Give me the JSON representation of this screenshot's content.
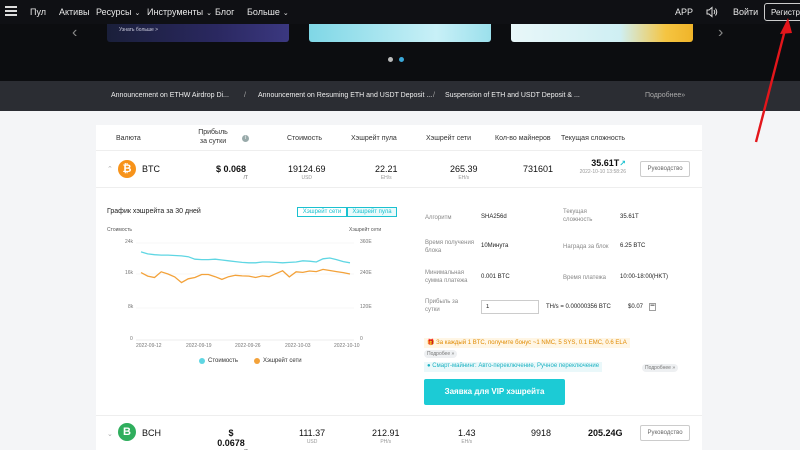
{
  "nav": {
    "items": [
      "Пул",
      "Активы",
      "Ресурсы",
      "Инструменты",
      "Блог",
      "Больше"
    ],
    "app": "APP",
    "login": "Войти",
    "register": "Регистрация"
  },
  "banner": {
    "slide1_text": "Узнать больше >"
  },
  "announcements": {
    "items": [
      "Announcement on ETHW Airdrop Di...",
      "Announcement on Resuming ETH and USDT Deposit ...",
      "Suspension of ETH and USDT Deposit & ..."
    ],
    "more": "Подробнее»"
  },
  "table": {
    "headers": {
      "currency": "Валюта",
      "profit": "Прибыль за сутки",
      "price": "Стоимость",
      "pool_hash": "Хэшрейт пула",
      "net_hash": "Хэшрейт сети",
      "miners": "Кол-во майнеров",
      "difficulty": "Текущая сложность"
    },
    "rows": [
      {
        "coin": "BTC",
        "profit": "$ 0.068",
        "profit_unit": "/T",
        "price": "19124.69",
        "price_unit": "USD",
        "pool_hash": "22.21",
        "pool_hash_unit": "EH/s",
        "net_hash": "265.39",
        "net_hash_unit": "EH/s",
        "miners": "731601",
        "difficulty": "35.61T",
        "difficulty_time": "2022-10-10 13:58:26",
        "guide": "Руководство"
      },
      {
        "coin": "BCH",
        "profit": "$ 0.0678",
        "profit_unit": "/T",
        "price": "111.37",
        "price_unit": "USD",
        "pool_hash": "212.91",
        "pool_hash_unit": "PH/s",
        "net_hash": "1.43",
        "net_hash_unit": "EH/s",
        "miners": "9918",
        "difficulty": "205.24G",
        "guide": "Руководство"
      }
    ]
  },
  "chart_data": {
    "type": "line",
    "title": "График хэшрейта за 30 дней",
    "toggles": [
      "Хэшрейт сети",
      "Хэшрейт пула"
    ],
    "ylabel_left": "Стоимость",
    "ylabel_right": "Хэшрейт сети",
    "left_ticks": [
      "24k",
      "16k",
      "8k",
      "0"
    ],
    "right_ticks": [
      "360E",
      "240E",
      "120E",
      "0"
    ],
    "x_ticks": [
      "2022-09-12",
      "2022-09-19",
      "2022-09-26",
      "2022-10-03",
      "2022-10-10"
    ],
    "ylim_left": [
      0,
      24000
    ],
    "ylim_right": [
      0,
      360
    ],
    "series": [
      {
        "name": "Стоимость",
        "color": "#5fd6e3",
        "axis": "left",
        "values": [
          21800,
          21300,
          21100,
          21000,
          21000,
          20900,
          20800,
          20600,
          20000,
          19900,
          19900,
          20000,
          19800,
          19600,
          19400,
          19200,
          19100,
          19100,
          19300,
          19300,
          19200,
          19100,
          19200,
          19300,
          19600,
          19500,
          19300,
          20100,
          20300,
          19900,
          19400,
          19100
        ]
      },
      {
        "name": "Хэшрейт сети",
        "color": "#f3a23a",
        "axis": "right",
        "values": [
          250,
          237,
          232,
          253,
          245,
          234,
          213,
          227,
          232,
          243,
          243,
          235,
          225,
          235,
          240,
          238,
          237,
          232,
          238,
          235,
          246,
          257,
          234,
          253,
          251,
          256,
          254,
          262,
          258,
          254,
          250,
          245
        ]
      }
    ]
  },
  "params": {
    "algorithm_label": "Алгоритм",
    "algorithm": "SHA256d",
    "difficulty_label": "Текущая сложность",
    "difficulty": "35.61T",
    "block_time_label": "Время получения блока",
    "block_time": "10Минута",
    "block_reward_label": "Награда за блок",
    "block_reward": "6.25 BTC",
    "min_pay_label": "Минимальная сумма платежа",
    "min_pay": "0.001 BTC",
    "pay_time_label": "Время платежа",
    "pay_time": "10:00-18:00(HKT)",
    "profit_label": "Прибыль за сутки",
    "input_value": "1",
    "calc_result": "TH/s = 0.00000356 BTC",
    "calc_usd": "$0.07"
  },
  "promo": {
    "bonus": "За каждый 1 BTC, получите бонус ~1 NMC, 5 SYS, 0.1 EMC, 0.6 ELA",
    "bonus_more": "Подробее »",
    "smart": "Смарт-майнинг: Авто-переключение, Ручное переключение",
    "smart_more": "Подробнее »",
    "vip": "Заявка для VIP хэшрейта"
  }
}
